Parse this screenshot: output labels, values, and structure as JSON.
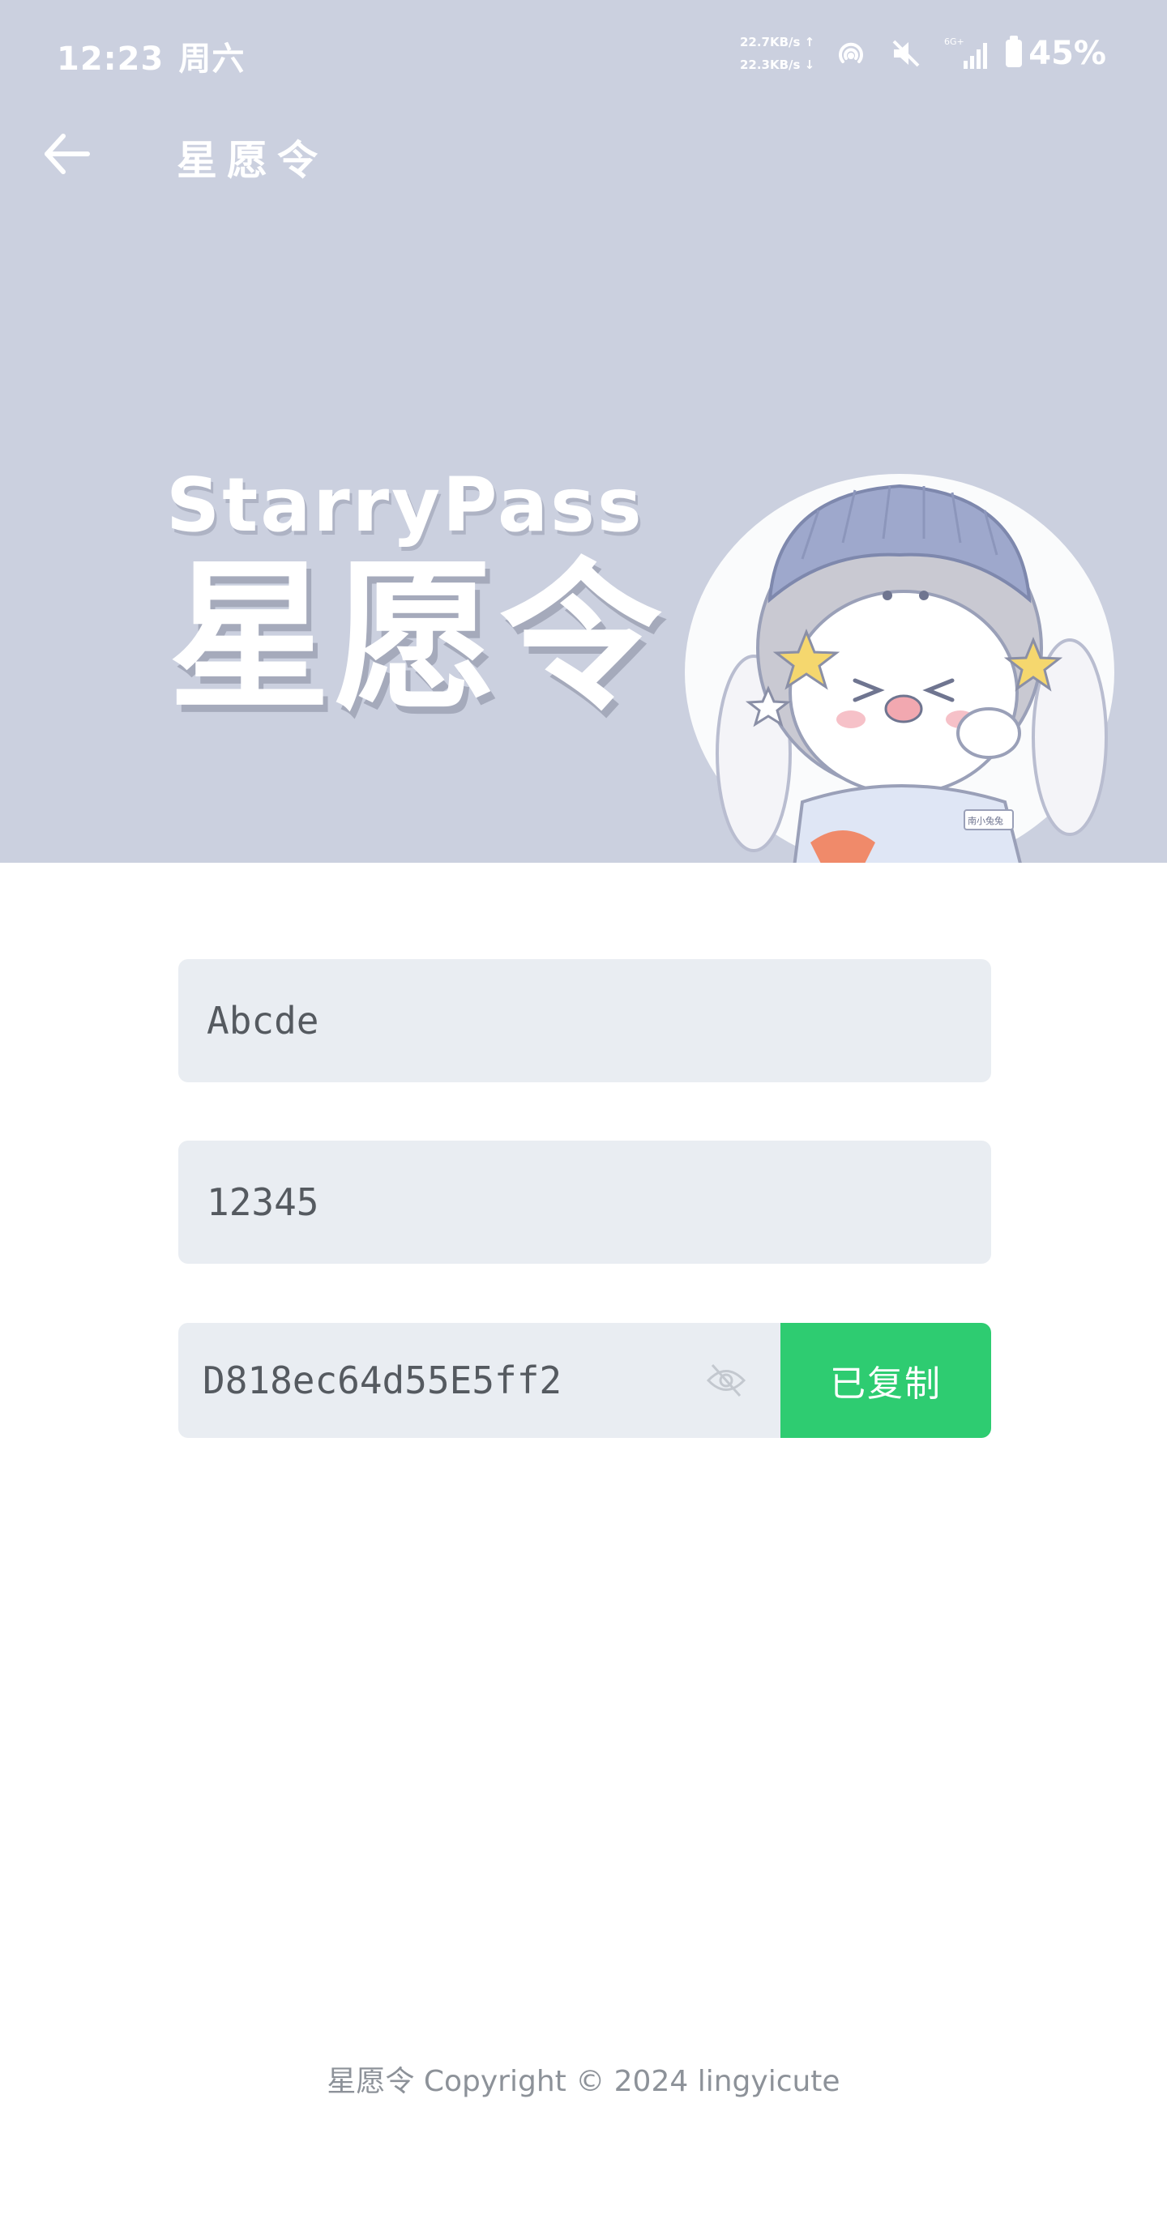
{
  "status_bar": {
    "time": "12:23",
    "day": "周六",
    "net_up": "22.7KB/s ↑",
    "net_down": "22.3KB/s ↓",
    "network_type": "6G+",
    "battery": "45%",
    "icons": [
      "hotspot-icon",
      "mute-icon",
      "signal-icon",
      "battery-icon"
    ]
  },
  "appbar": {
    "back_icon": "arrow-left-icon",
    "title": "星愿令"
  },
  "hero": {
    "brand_en": "StarryPass",
    "brand_cn": "星愿令",
    "background": "#cbd0df",
    "mascot_badge": "南小兔兔"
  },
  "form": {
    "username_value": "Abcde",
    "password_value": "12345",
    "generated_value": "D818ec64d55E5ff2",
    "visibility_icon": "eye-off-icon",
    "copy_label": "已复制"
  },
  "colors": {
    "accent": "#2ecc71",
    "field_bg": "#e9edf2"
  },
  "footer": {
    "text": "星愿令 Copyright © 2024 lingyicute"
  }
}
